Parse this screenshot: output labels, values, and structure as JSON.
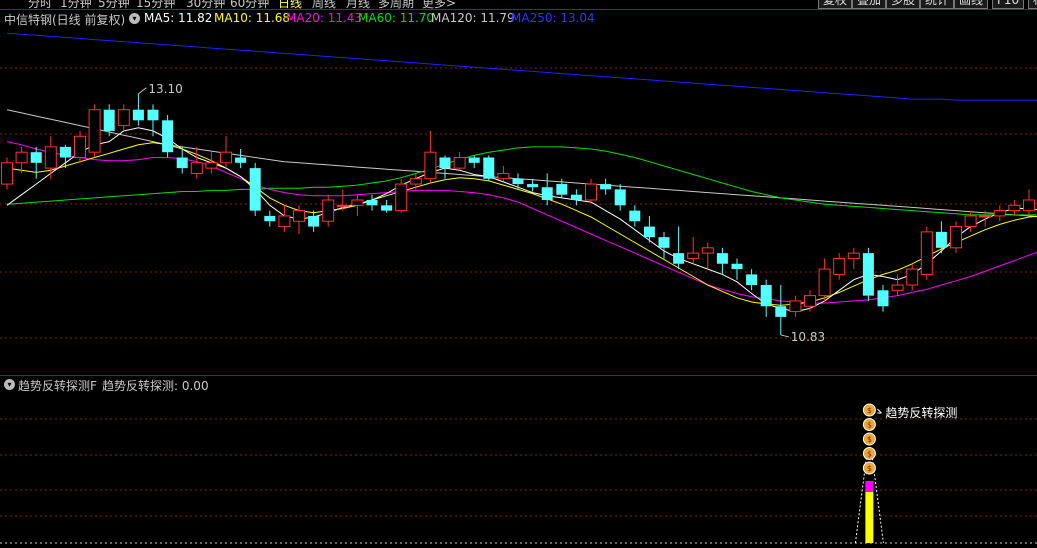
{
  "toolbar": {
    "timeframes": [
      {
        "label": "分时",
        "active": false
      },
      {
        "label": "1分钟",
        "active": false
      },
      {
        "label": "5分钟",
        "active": false
      },
      {
        "label": "15分钟",
        "active": false
      },
      {
        "label": "30分钟",
        "active": false
      },
      {
        "label": "60分钟",
        "active": false
      },
      {
        "label": "日线",
        "active": true
      },
      {
        "label": "周线",
        "active": false
      },
      {
        "label": "月线",
        "active": false
      },
      {
        "label": "多周期",
        "active": false
      },
      {
        "label": "更多>",
        "active": false
      }
    ],
    "buttons": [
      "复权",
      "叠加",
      "多股",
      "统计",
      "画线",
      "F10",
      "标"
    ]
  },
  "main_header": {
    "stock": "中信特钢(日线 前复权)",
    "indicators": [
      {
        "label": "MA5: 11.82",
        "color": "#ffffff"
      },
      {
        "label": "MA10: 11.68",
        "color": "#ffff00"
      },
      {
        "label": "MA20: 11.43",
        "color": "#ff00ff"
      },
      {
        "label": "MA60: 11.70",
        "color": "#00e000"
      },
      {
        "label": "MA120: 11.79",
        "color": "#c8c8c8"
      },
      {
        "label": "MA250: 13.04",
        "color": "#3333ff"
      }
    ]
  },
  "sub_header": {
    "name": "趋势反转探测F",
    "value_label": "趋势反转探测: 0.00"
  },
  "colors": {
    "up": "#ff3232",
    "down": "#54ffff",
    "ma5": "#ffffff",
    "ma10": "#ffff00",
    "ma20": "#ff00ff",
    "ma60": "#00e000",
    "ma120": "#c8c8c8",
    "ma250": "#2020ff",
    "grid": "#8b1a1a",
    "signal_bar": "#ffff00",
    "signal_cap": "#ff00ff"
  },
  "chart_data": {
    "type": "candlestick",
    "price_range": [
      10.5,
      13.7
    ],
    "high_label": "13.10",
    "low_label": "10.83",
    "candles": [
      [
        12.25,
        12.45,
        12.5,
        12.2
      ],
      [
        12.45,
        12.55,
        12.6,
        12.35
      ],
      [
        12.55,
        12.45,
        12.6,
        12.3
      ],
      [
        12.4,
        12.6,
        12.7,
        12.3
      ],
      [
        12.6,
        12.5,
        12.62,
        12.4
      ],
      [
        12.5,
        12.7,
        12.75,
        12.45
      ],
      [
        12.55,
        12.95,
        13.0,
        12.5
      ],
      [
        12.95,
        12.75,
        13.0,
        12.7
      ],
      [
        12.8,
        12.95,
        13.0,
        12.75
      ],
      [
        12.95,
        12.85,
        13.1,
        12.8
      ],
      [
        12.95,
        12.85,
        13.0,
        12.7
      ],
      [
        12.85,
        12.55,
        12.9,
        12.5
      ],
      [
        12.5,
        12.4,
        12.6,
        12.35
      ],
      [
        12.35,
        12.45,
        12.6,
        12.3
      ],
      [
        12.4,
        12.45,
        12.55,
        12.35
      ],
      [
        12.45,
        12.55,
        12.7,
        12.4
      ],
      [
        12.5,
        12.45,
        12.58,
        12.4
      ],
      [
        12.4,
        12.0,
        12.45,
        11.95
      ],
      [
        11.95,
        11.9,
        12.0,
        11.85
      ],
      [
        11.85,
        11.95,
        12.05,
        11.8
      ],
      [
        11.9,
        12.0,
        12.05,
        11.78
      ],
      [
        11.95,
        11.85,
        12.0,
        11.8
      ],
      [
        11.9,
        12.1,
        12.15,
        11.85
      ],
      [
        12.05,
        12.05,
        12.2,
        12.0
      ],
      [
        12.05,
        12.1,
        12.15,
        11.95
      ],
      [
        12.1,
        12.05,
        12.15,
        12.0
      ],
      [
        12.05,
        12.0,
        12.1,
        11.98
      ],
      [
        12.0,
        12.25,
        12.3,
        11.98
      ],
      [
        12.25,
        12.3,
        12.35,
        12.2
      ],
      [
        12.3,
        12.55,
        12.75,
        12.25
      ],
      [
        12.5,
        12.4,
        12.52,
        12.3
      ],
      [
        12.4,
        12.5,
        12.55,
        12.38
      ],
      [
        12.5,
        12.45,
        12.52,
        12.4
      ],
      [
        12.5,
        12.3,
        12.52,
        12.28
      ],
      [
        12.3,
        12.35,
        12.42,
        12.28
      ],
      [
        12.3,
        12.25,
        12.35,
        12.2
      ],
      [
        12.25,
        12.22,
        12.3,
        12.18
      ],
      [
        12.22,
        12.1,
        12.35,
        12.05
      ],
      [
        12.25,
        12.15,
        12.3,
        12.12
      ],
      [
        12.15,
        12.1,
        12.2,
        12.05
      ],
      [
        12.1,
        12.25,
        12.3,
        12.08
      ],
      [
        12.25,
        12.2,
        12.3,
        12.15
      ],
      [
        12.2,
        12.05,
        12.25,
        12.0
      ],
      [
        12.0,
        11.9,
        12.05,
        11.85
      ],
      [
        11.85,
        11.75,
        11.95,
        11.7
      ],
      [
        11.75,
        11.65,
        11.8,
        11.55
      ],
      [
        11.6,
        11.5,
        11.85,
        11.45
      ],
      [
        11.55,
        11.6,
        11.75,
        11.5
      ],
      [
        11.6,
        11.65,
        11.7,
        11.45
      ],
      [
        11.6,
        11.5,
        11.65,
        11.4
      ],
      [
        11.5,
        11.45,
        11.55,
        11.35
      ],
      [
        11.4,
        11.3,
        11.45,
        11.25
      ],
      [
        11.3,
        11.1,
        11.35,
        11.0
      ],
      [
        11.1,
        11.0,
        11.3,
        10.83
      ],
      [
        11.05,
        11.15,
        11.2,
        11.0
      ],
      [
        11.1,
        11.2,
        11.25,
        11.05
      ],
      [
        11.2,
        11.45,
        11.55,
        11.15
      ],
      [
        11.4,
        11.55,
        11.6,
        11.35
      ],
      [
        11.55,
        11.6,
        11.65,
        11.45
      ],
      [
        11.6,
        11.2,
        11.65,
        11.15
      ],
      [
        11.25,
        11.1,
        11.3,
        11.05
      ],
      [
        11.25,
        11.3,
        11.4,
        11.2
      ],
      [
        11.3,
        11.45,
        11.5,
        11.25
      ],
      [
        11.4,
        11.8,
        11.85,
        11.35
      ],
      [
        11.8,
        11.65,
        11.9,
        11.6
      ],
      [
        11.65,
        11.85,
        11.9,
        11.6
      ],
      [
        11.85,
        11.95,
        12.0,
        11.8
      ],
      [
        11.95,
        11.95,
        12.0,
        11.85
      ],
      [
        11.95,
        12.0,
        12.05,
        11.9
      ],
      [
        12.0,
        12.05,
        12.1,
        11.95
      ],
      [
        12.0,
        12.1,
        12.2,
        11.95
      ],
      [
        12.1,
        11.98,
        12.15,
        11.9
      ]
    ],
    "ma5": [
      12.05,
      12.15,
      12.25,
      12.35,
      12.45,
      12.55,
      12.62,
      12.65,
      12.75,
      12.78,
      12.75,
      12.68,
      12.58,
      12.5,
      12.45,
      12.4,
      12.32,
      12.2,
      12.05,
      11.95,
      11.92,
      11.94,
      11.98,
      12.03,
      12.06,
      12.1,
      12.16,
      12.24,
      12.3,
      12.36,
      12.4,
      12.38,
      12.34,
      12.32,
      12.27,
      12.22,
      12.17,
      12.14,
      12.12,
      12.1,
      12.08,
      12.0,
      11.92,
      11.82,
      11.72,
      11.62,
      11.55,
      11.5,
      11.45,
      11.4,
      11.33,
      11.22,
      11.12,
      11.08,
      11.05,
      11.08,
      11.15,
      11.25,
      11.35,
      11.4,
      11.38,
      11.35,
      11.4,
      11.5,
      11.62,
      11.75,
      11.85,
      11.92,
      11.98,
      12.02,
      12.02,
      12.0
    ],
    "ma10": [
      12.4,
      12.38,
      12.36,
      12.38,
      12.42,
      12.46,
      12.5,
      12.54,
      12.58,
      12.62,
      12.64,
      12.62,
      12.58,
      12.53,
      12.47,
      12.4,
      12.32,
      12.22,
      12.12,
      12.05,
      12.0,
      11.98,
      12.0,
      12.02,
      12.05,
      12.1,
      12.14,
      12.18,
      12.22,
      12.26,
      12.29,
      12.31,
      12.3,
      12.28,
      12.24,
      12.2,
      12.16,
      12.11,
      12.06,
      12.0,
      11.94,
      11.86,
      11.78,
      11.7,
      11.62,
      11.54,
      11.46,
      11.38,
      11.3,
      11.24,
      11.18,
      11.14,
      11.12,
      11.11,
      11.12,
      11.14,
      11.18,
      11.23,
      11.29,
      11.35,
      11.4,
      11.44,
      11.5,
      11.57,
      11.64,
      11.7,
      11.76,
      11.82,
      11.87,
      11.91,
      11.94,
      11.95
    ],
    "ma20": [
      12.65,
      12.62,
      12.58,
      12.55,
      12.52,
      12.5,
      12.48,
      12.47,
      12.47,
      12.48,
      12.5,
      12.5,
      12.49,
      12.46,
      12.42,
      12.36,
      12.3,
      12.24,
      12.2,
      12.17,
      12.15,
      12.14,
      12.14,
      12.14,
      12.15,
      12.16,
      12.17,
      12.18,
      12.19,
      12.19,
      12.19,
      12.18,
      12.17,
      12.15,
      12.12,
      12.08,
      12.02,
      11.96,
      11.9,
      11.84,
      11.78,
      11.72,
      11.66,
      11.6,
      11.54,
      11.48,
      11.42,
      11.36,
      11.3,
      11.26,
      11.22,
      11.19,
      11.17,
      11.15,
      11.14,
      11.13,
      11.13,
      11.14,
      11.15,
      11.16,
      11.18,
      11.2,
      11.23,
      11.26,
      11.3,
      11.34,
      11.38,
      11.43,
      11.48,
      11.53,
      11.58,
      11.63
    ],
    "ma60": [
      12.06,
      12.07,
      12.08,
      12.09,
      12.1,
      12.11,
      12.12,
      12.13,
      12.14,
      12.15,
      12.16,
      12.17,
      12.18,
      12.18,
      12.19,
      12.19,
      12.2,
      12.2,
      12.21,
      12.21,
      12.21,
      12.22,
      12.22,
      12.23,
      12.24,
      12.26,
      12.28,
      12.31,
      12.35,
      12.39,
      12.44,
      12.48,
      12.52,
      12.55,
      12.57,
      12.59,
      12.6,
      12.6,
      12.6,
      12.59,
      12.58,
      12.56,
      12.53,
      12.5,
      12.46,
      12.42,
      12.38,
      12.34,
      12.3,
      12.26,
      12.22,
      12.18,
      12.15,
      12.12,
      12.1,
      12.08,
      12.06,
      12.05,
      12.04,
      12.03,
      12.02,
      12.01,
      12.0,
      11.99,
      11.98,
      11.97,
      11.96,
      11.96,
      11.96,
      11.96,
      11.96,
      11.96
    ],
    "ma120": [
      12.95,
      12.92,
      12.89,
      12.86,
      12.83,
      12.8,
      12.77,
      12.74,
      12.71,
      12.68,
      12.65,
      12.62,
      12.6,
      12.58,
      12.56,
      12.54,
      12.52,
      12.5,
      12.48,
      12.46,
      12.45,
      12.44,
      12.43,
      12.42,
      12.41,
      12.4,
      12.39,
      12.38,
      12.37,
      12.36,
      12.35,
      12.34,
      12.33,
      12.32,
      12.31,
      12.3,
      12.29,
      12.28,
      12.27,
      12.26,
      12.25,
      12.24,
      12.23,
      12.22,
      12.21,
      12.2,
      12.19,
      12.18,
      12.17,
      12.16,
      12.15,
      12.14,
      12.13,
      12.12,
      12.11,
      12.1,
      12.09,
      12.08,
      12.07,
      12.06,
      12.05,
      12.04,
      12.03,
      12.02,
      12.01,
      12.0,
      11.99,
      11.98,
      11.97,
      11.96,
      11.95,
      11.94
    ],
    "ma250": [
      13.67,
      13.66,
      13.65,
      13.64,
      13.63,
      13.62,
      13.61,
      13.6,
      13.59,
      13.58,
      13.57,
      13.56,
      13.55,
      13.54,
      13.53,
      13.52,
      13.51,
      13.5,
      13.49,
      13.48,
      13.47,
      13.46,
      13.45,
      13.44,
      13.43,
      13.42,
      13.41,
      13.4,
      13.39,
      13.38,
      13.37,
      13.36,
      13.35,
      13.34,
      13.33,
      13.32,
      13.31,
      13.3,
      13.29,
      13.28,
      13.27,
      13.26,
      13.25,
      13.24,
      13.23,
      13.22,
      13.21,
      13.2,
      13.19,
      13.18,
      13.17,
      13.16,
      13.15,
      13.14,
      13.13,
      13.12,
      13.11,
      13.1,
      13.09,
      13.08,
      13.07,
      13.06,
      13.05,
      13.05,
      13.05,
      13.04,
      13.04,
      13.04,
      13.04,
      13.04,
      13.04,
      13.04
    ],
    "signal": {
      "index": 59,
      "label": "趋势反转探测",
      "icon_count": 5
    }
  }
}
